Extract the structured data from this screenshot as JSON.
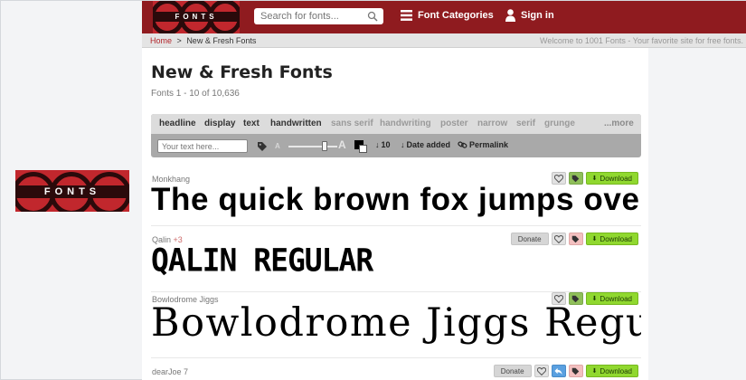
{
  "side_logo": {
    "text": "FONTS"
  },
  "header": {
    "logo_text": "FONTS",
    "search_placeholder": "Search for fonts...",
    "categories_label": "Font Categories",
    "signin_label": "Sign in"
  },
  "breadcrumb": {
    "home": "Home",
    "separator": ">",
    "current": "New & Fresh Fonts",
    "welcome": "Welcome to 1001 Fonts - Your favorite site for free fonts."
  },
  "main": {
    "title": "New & Fresh Fonts",
    "count": "Fonts 1 - 10 of 10,636"
  },
  "filters": {
    "categories": [
      {
        "label": "headline",
        "style": "dark"
      },
      {
        "label": "display",
        "style": "dark"
      },
      {
        "label": "text",
        "style": "dark"
      },
      {
        "label": "handwritten",
        "style": "dark"
      },
      {
        "label": "sans serif",
        "style": "light"
      },
      {
        "label": "handwriting",
        "style": "light"
      },
      {
        "label": "poster",
        "style": "light"
      },
      {
        "label": "narrow",
        "style": "light"
      },
      {
        "label": "serif",
        "style": "light"
      },
      {
        "label": "grunge",
        "style": "light"
      }
    ],
    "more_label": "...more",
    "preview_placeholder": "Your text here...",
    "size_small": "A",
    "size_large": "A",
    "per_page": "10",
    "sort_label": "Date added",
    "permalink_label": "Permalink"
  },
  "fonts": [
    {
      "name": "Monkhang",
      "extra": "",
      "sample": "The quick brown fox jumps over",
      "donate": "",
      "download": "Download"
    },
    {
      "name": "Qalin",
      "extra": "+3",
      "sample": "QALIN REGULAR",
      "donate": "Donate",
      "download": "Download"
    },
    {
      "name": "Bowlodrome Jiggs",
      "extra": "",
      "sample": "Bowlodrome Jiggs Regular",
      "donate": "",
      "download": "Download"
    },
    {
      "name": "dearJoe 7",
      "extra": "",
      "sample": "",
      "donate": "Donate",
      "download": "Download"
    }
  ],
  "colors": {
    "brand_dark": "#8f1b1f",
    "brand_red": "#c1272d",
    "download_green": "#90d82f"
  }
}
